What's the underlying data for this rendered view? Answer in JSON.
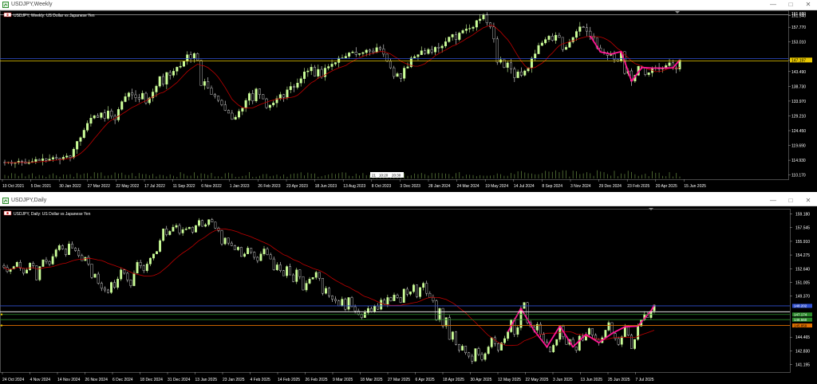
{
  "colors": {
    "background": "#000000",
    "bull": "#ccff99",
    "bear": "#e8e8e8",
    "ma": "#c00000",
    "zigzag": "#ff1493",
    "hline_blue": "#3050d0",
    "hline_yellow": "#e8c800",
    "hline_orange": "#e07000",
    "axis_text": "#ffffff"
  },
  "weekly": {
    "window_title": "USDJPY,Weekly",
    "chart_label": "USDJPY, Weekly:  US Dollar vs Japanese Yen",
    "price_labels": [
      "161.680",
      "161.540",
      "157.770",
      "153.010",
      "147.197",
      "143.490",
      "138.730",
      "133.970",
      "129.210",
      "124.450",
      "119.690",
      "114.930",
      "110.170"
    ],
    "current_price": "147.197",
    "date_labels": [
      "10 Oct 2021",
      "5 Dec 2021",
      "30 Jan 2022",
      "27 Mar 2022",
      "22 May 2022",
      "17 Jul 2022",
      "11 Sep 2022",
      "6 Nov 2022",
      "1 Jan 2023",
      "26 Feb 2023",
      "23 Apr 2023",
      "18 Jun 2023",
      "13 Aug 2023",
      "8 Oct 2023",
      "3 Dec 2023",
      "28 Jan 2024",
      "24 Mar 2024",
      "19 May 2024",
      "14 Jul 2024",
      "8 Sep 2024",
      "3 Nov 2024",
      "29 Dec 2024",
      "23 Feb 2025",
      "20 Apr 2025",
      "15 Jun 2025"
    ],
    "cursor_label_left": "21",
    "cursor_label_mid": "10:20",
    "cursor_label_right": "20:30",
    "chart_data": {
      "type": "candlestick",
      "ylim": [
        108.8,
        163.2
      ],
      "closes": [
        114.1,
        114.3,
        113.9,
        114.2,
        114.6,
        114.4,
        113.9,
        114.3,
        114.5,
        115.2,
        114.8,
        115.4,
        114.9,
        115.3,
        115.8,
        115.5,
        115.2,
        115.9,
        116.3,
        115.8,
        118.5,
        121.0,
        122.2,
        124.6,
        126.8,
        128.5,
        129.3,
        128.7,
        130.2,
        128.4,
        130.8,
        129.1,
        127.9,
        131.3,
        133.8,
        135.4,
        136.6,
        136.0,
        135.1,
        134.6,
        136.5,
        133.4,
        135.0,
        136.9,
        138.8,
        141.9,
        139.4,
        143.2,
        142.3,
        143.6,
        144.9,
        145.2,
        146.8,
        148.9,
        147.7,
        149.3,
        147.1,
        139.0,
        140.3,
        138.2,
        136.1,
        135.6,
        134.2,
        132.8,
        131.0,
        130.1,
        128.1,
        128.8,
        130.7,
        131.7,
        134.2,
        136.4,
        134.0,
        137.9,
        136.1,
        134.7,
        131.9,
        132.7,
        133.4,
        134.8,
        136.1,
        135.2,
        137.6,
        138.7,
        138.4,
        139.8,
        141.2,
        143.4,
        143.7,
        144.9,
        142.0,
        144.2,
        141.8,
        144.6,
        145.1,
        145.9,
        146.4,
        147.8,
        147.9,
        148.4,
        149.5,
        149.8,
        149.0,
        149.3,
        149.6,
        150.4,
        150.1,
        149.7,
        151.2,
        150.8,
        149.1,
        146.8,
        144.7,
        141.9,
        142.8,
        141.3,
        144.6,
        145.0,
        147.9,
        148.3,
        148.9,
        150.2,
        149.3,
        150.6,
        149.8,
        151.3,
        151.1,
        151.7,
        153.1,
        154.6,
        155.4,
        153.8,
        155.9,
        156.7,
        157.2,
        157.4,
        157.8,
        159.9,
        160.4,
        161.7,
        159.2,
        157.9,
        154.0,
        146.5,
        147.3,
        144.8,
        146.3,
        144.3,
        141.5,
        143.4,
        142.3,
        143.7,
        144.7,
        147.8,
        149.2,
        151.9,
        152.7,
        153.8,
        154.9,
        153.5,
        155.2,
        154.5,
        150.6,
        151.3,
        153.0,
        154.5,
        156.4,
        157.9,
        157.6,
        156.5,
        154.9,
        154.3,
        151.1,
        149.8,
        149.5,
        148.7,
        149.1,
        147.4,
        146.9,
        149.9,
        142.9,
        143.7,
        140.4,
        142.3,
        145.2,
        144.8,
        142.5,
        143.1,
        144.6,
        144.8,
        144.3,
        144.6,
        145.4,
        146.3,
        144.7,
        144.3,
        147.2
      ]
    }
  },
  "daily": {
    "window_title": "USDJPY,Daily",
    "chart_label": "USDJPY, Daily:  US Dollar vs Japanese Yen",
    "price_labels": [
      "159.180",
      "157.545",
      "155.910",
      "154.275",
      "152.640",
      "151.005",
      "149.370",
      "147.735",
      "146.100",
      "144.465",
      "142.830",
      "141.195"
    ],
    "tag_blue": "148.202",
    "tag_green": "147.174",
    "tag_green2": "146.560",
    "tag_orange": "145.859",
    "date_labels": [
      "24 Oct 2024",
      "4 Nov 2024",
      "14 Nov 2024",
      "26 Nov 2024",
      "6 Dec 2024",
      "18 Dec 2024",
      "31 Dec 2024",
      "13 Jan 2025",
      "23 Jan 2025",
      "4 Feb 2025",
      "14 Feb 2025",
      "26 Feb 2025",
      "9 Mar 2025",
      "18 Mar 2025",
      "27 Mar 2025",
      "6 Apr 2025",
      "18 Apr 2025",
      "30 Apr 2025",
      "12 May 2025",
      "22 May 2025",
      "3 Jun 2025",
      "13 Jun 2025",
      "25 Jun 2025",
      "7 Jul 2025"
    ],
    "chart_data": {
      "type": "candlestick",
      "ylim": [
        140.3,
        159.8
      ],
      "closes": [
        152.8,
        152.3,
        152.6,
        152.9,
        153.4,
        152.7,
        152.1,
        152.5,
        153.3,
        153.0,
        151.3,
        152.9,
        153.7,
        153.5,
        153.2,
        154.1,
        154.9,
        155.4,
        155.0,
        154.3,
        155.6,
        155.1,
        154.8,
        154.2,
        153.6,
        154.0,
        153.2,
        151.6,
        152.0,
        150.9,
        150.3,
        150.1,
        149.8,
        151.0,
        150.4,
        151.4,
        152.5,
        152.1,
        151.3,
        150.6,
        152.1,
        153.4,
        153.0,
        152.4,
        153.2,
        153.9,
        154.4,
        154.7,
        156.0,
        157.4,
        156.7,
        157.1,
        157.6,
        157.8,
        156.9,
        157.3,
        157.4,
        157.6,
        157.0,
        157.8,
        158.4,
        157.7,
        157.9,
        158.5,
        158.2,
        157.5,
        157.2,
        155.6,
        156.3,
        155.7,
        155.4,
        154.9,
        155.2,
        154.1,
        154.4,
        155.1,
        154.6,
        154.0,
        153.6,
        154.4,
        155.0,
        154.3,
        153.8,
        152.5,
        153.1,
        152.4,
        151.8,
        152.9,
        151.9,
        151.1,
        152.5,
        151.7,
        150.1,
        150.9,
        151.4,
        151.6,
        152.2,
        151.5,
        149.7,
        150.3,
        149.4,
        149.0,
        148.8,
        148.2,
        149.0,
        147.8,
        149.2,
        148.1,
        147.6,
        147.2,
        146.8,
        147.4,
        147.9,
        147.5,
        148.2,
        147.8,
        148.9,
        148.4,
        149.2,
        148.8,
        149.5,
        149.2,
        148.6,
        150.2,
        149.6,
        149.9,
        150.7,
        149.3,
        150.4,
        150.9,
        149.7,
        149.2,
        148.8,
        146.5,
        147.9,
        145.8,
        146.8,
        144.2,
        145.1,
        143.6,
        142.9,
        143.4,
        142.6,
        142.2,
        141.6,
        143.1,
        142.4,
        141.8,
        142.5,
        143.3,
        144.4,
        143.7,
        142.9,
        143.8,
        144.3,
        145.1,
        146.5,
        144.8,
        145.6,
        147.9,
        148.6,
        146.2,
        145.7,
        145.3,
        146.0,
        144.8,
        143.9,
        143.3,
        142.7,
        143.5,
        144.2,
        145.8,
        144.5,
        143.6,
        144.2,
        143.3,
        142.9,
        144.6,
        144.1,
        144.8,
        145.5,
        144.7,
        144.2,
        143.8,
        144.4,
        145.3,
        146.2,
        144.9,
        144.3,
        143.6,
        144.5,
        145.7,
        144.7,
        143.1,
        144.2,
        145.8,
        146.5,
        147.2,
        146.8,
        147.6,
        148.3
      ]
    }
  }
}
